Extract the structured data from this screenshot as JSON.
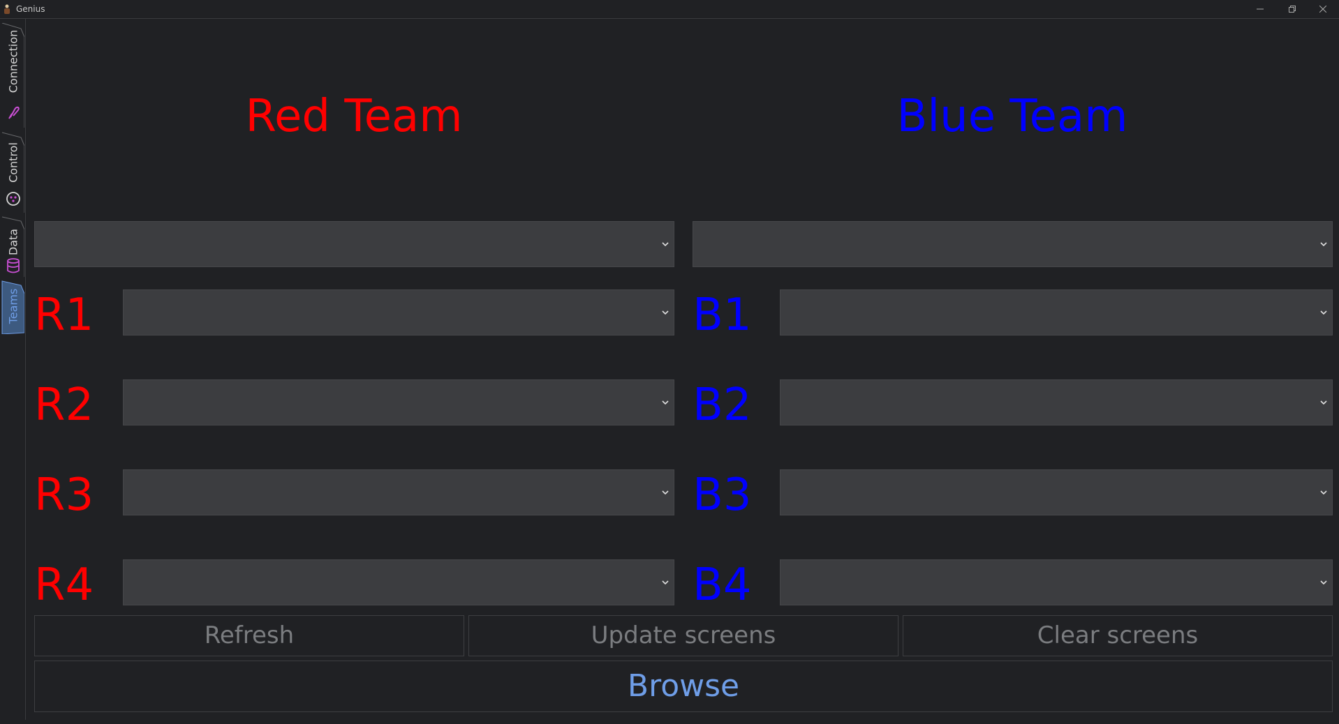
{
  "window": {
    "title": "Genius"
  },
  "tabs": [
    {
      "label": "Connection",
      "icon": "plug-icon"
    },
    {
      "label": "Control",
      "icon": "gamepad-icon"
    },
    {
      "label": "Data",
      "icon": "database-icon"
    },
    {
      "label": "Teams",
      "icon": "none",
      "active": true
    }
  ],
  "red": {
    "title": "Red Team",
    "color": "#ff0000",
    "team_select": "",
    "slots": [
      {
        "label": "R1",
        "value": ""
      },
      {
        "label": "R2",
        "value": ""
      },
      {
        "label": "R3",
        "value": ""
      },
      {
        "label": "R4",
        "value": ""
      }
    ]
  },
  "blue": {
    "title": "Blue Team",
    "color": "#0000ff",
    "team_select": "",
    "slots": [
      {
        "label": "B1",
        "value": ""
      },
      {
        "label": "B2",
        "value": ""
      },
      {
        "label": "B3",
        "value": ""
      },
      {
        "label": "B4",
        "value": ""
      }
    ]
  },
  "buttons": {
    "refresh": "Refresh",
    "update": "Update screens",
    "clear": "Clear screens",
    "browse": "Browse"
  },
  "colors": {
    "accent": "#6f9ee8",
    "tab_icon": "#c94fd4"
  }
}
